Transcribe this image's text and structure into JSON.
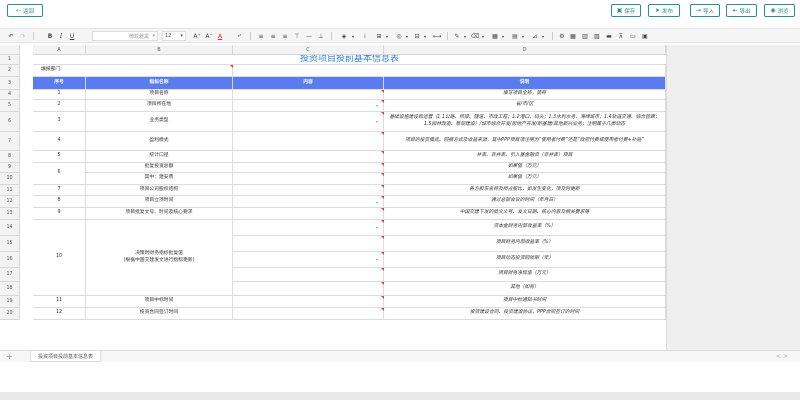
{
  "header": {
    "back_label": "返回",
    "save_label": "保存",
    "publish_label": "发布",
    "import_label": "导入",
    "export_label": "导出",
    "preview_label": "浏览"
  },
  "toolbar": {
    "undo_icon": "undo-icon",
    "redo_icon": "redo-icon",
    "bold": "B",
    "italic": "I",
    "underline": "U",
    "font_family": "微软雅黑",
    "font_size": "12",
    "grow": "A⁺",
    "shrink": "A⁻",
    "font_color": "A"
  },
  "columns": [
    "A",
    "B",
    "C",
    "D"
  ],
  "sheet": {
    "title": "投资项目投前基本信息表",
    "fill_dept_label": "填报部门:",
    "headers": [
      "序号",
      "指标名称",
      "内容",
      "说明"
    ],
    "rows": [
      {
        "r": "4",
        "no": "1",
        "name": "项目名称",
        "desc": "填写项目全称，简称"
      },
      {
        "r": "5",
        "no": "2",
        "name": "项目所在地",
        "desc": "省/市/区"
      },
      {
        "r": "6",
        "no": "3",
        "name": "业务类型",
        "desc": "基础设施建设和运营（1.1公路、桥梁、隧道、市政工程；1.2港口、码头；1.3水利水务、海绵城市；1.4轨道交通、综合管廊；1.5园林改造、景观建设）/城市综合开发/房地产开发/新基建/其他新兴业务；注明属于几类动态"
      },
      {
        "r": "7",
        "no": "4",
        "name": "盈利模式",
        "desc": "项目的投资模式、回报方式及收益来源，其中PPP项目须注明为“使用者付费”还是“政府付费或使用者付费+补贴”"
      },
      {
        "r": "8",
        "no": "5",
        "name": "统计口径",
        "desc": "并表、非并表、引入基金融资（非并表）项目"
      },
      {
        "r": "9",
        "no": "6",
        "name": "批复投资总额",
        "desc": "如果值（万元）"
      },
      {
        "r": "10",
        "no": "",
        "name": "其中：建安费",
        "desc": "如果值（万元）"
      },
      {
        "r": "11",
        "no": "7",
        "name": "项目公司股权结构",
        "desc": "各方股东名称及所占股比，如发生变化，须及时更新"
      },
      {
        "r": "12",
        "no": "8",
        "name": "项目立项时间",
        "desc": "通过总部会议的时间（年月日）"
      },
      {
        "r": "13",
        "no": "9",
        "name": "项目批复文号、时间及核心要求",
        "desc": "中国交建下发的批文文号、发文日期、核心内容及相关要求等"
      },
      {
        "r": "14",
        "no": "",
        "name": "",
        "desc": "资本金财务内部收益率（%）"
      },
      {
        "r": "15",
        "no": "10",
        "name": "",
        "desc": "项目财务内部收益率（%）"
      },
      {
        "r": "16",
        "no": "",
        "name": "",
        "desc": "项目动态投资回收期（年）"
      },
      {
        "r": "17",
        "no": "",
        "name": "",
        "desc": "项目财务净现值（万元）"
      },
      {
        "r": "18",
        "no": "",
        "name": "",
        "desc": "其他（如有）"
      },
      {
        "r": "19",
        "no": "11",
        "name": "项目中标时间",
        "desc": "项目中标通知书时间"
      },
      {
        "r": "20",
        "no": "12",
        "name": "投资合同签订时间",
        "desc": "投资建设合同、投资建设协议、PPP合同签订的时间"
      }
    ],
    "merged_name_10": "决策时财务指标批复值\n(根据中国交建发文进行指标更新)"
  },
  "tabs": {
    "add": "+",
    "active_tab": "投资项目投前基本信息表",
    "nav": "< >"
  }
}
